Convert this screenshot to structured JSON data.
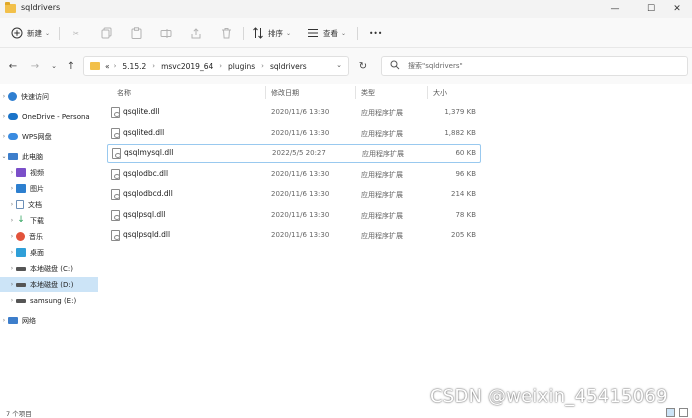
{
  "window": {
    "title": "sqldrivers",
    "minimize": "—",
    "maximize": "☐",
    "close": "✕"
  },
  "toolbar": {
    "new_label": "新建",
    "sort_label": "排序",
    "view_label": "查看",
    "more_label": "•••"
  },
  "nav": {
    "path": [
      "«",
      "5.15.2",
      "msvc2019_64",
      "plugins",
      "sqldrivers"
    ],
    "search_placeholder": "搜索\"sqldrivers\""
  },
  "sidebar": {
    "items": [
      {
        "label": "快速访问",
        "icon": "star-icon",
        "color": "#2f7fd1"
      },
      {
        "label": "OneDrive - Persona",
        "icon": "cloud-icon",
        "color": "#1a73c8"
      },
      {
        "label": "WPS网盘",
        "icon": "cloud-drive-icon",
        "color": "#3a8be0"
      },
      {
        "label": "此电脑",
        "icon": "computer-icon",
        "color": "#3d7ecb"
      },
      {
        "label": "视频",
        "icon": "video-icon",
        "color": "#7b4fc9"
      },
      {
        "label": "图片",
        "icon": "pictures-icon",
        "color": "#2d7fcf"
      },
      {
        "label": "文档",
        "icon": "documents-icon",
        "color": "#6c8fb7"
      },
      {
        "label": "下载",
        "icon": "download-icon",
        "color": "#2aa05a"
      },
      {
        "label": "音乐",
        "icon": "music-icon",
        "color": "#e2533b"
      },
      {
        "label": "桌面",
        "icon": "desktop-icon",
        "color": "#2f9fd8"
      },
      {
        "label": "本地磁盘 (C:)",
        "icon": "drive-icon",
        "color": "#555555"
      },
      {
        "label": "本地磁盘 (D:)",
        "icon": "drive-icon",
        "color": "#555555"
      },
      {
        "label": "samsung (E:)",
        "icon": "drive-icon",
        "color": "#555555"
      },
      {
        "label": "网络",
        "icon": "network-icon",
        "color": "#3d7ecb"
      }
    ]
  },
  "columns": {
    "name": "名称",
    "date": "修改日期",
    "type": "类型",
    "size": "大小"
  },
  "files": [
    {
      "name": "qsqlite.dll",
      "date": "2020/11/6 13:30",
      "type": "应用程序扩展",
      "size": "1,379 KB"
    },
    {
      "name": "qsqlited.dll",
      "date": "2020/11/6 13:30",
      "type": "应用程序扩展",
      "size": "1,882 KB"
    },
    {
      "name": "qsqlmysql.dll",
      "date": "2022/5/5 20:27",
      "type": "应用程序扩展",
      "size": "60 KB"
    },
    {
      "name": "qsqlodbc.dll",
      "date": "2020/11/6 13:30",
      "type": "应用程序扩展",
      "size": "96 KB"
    },
    {
      "name": "qsqlodbcd.dll",
      "date": "2020/11/6 13:30",
      "type": "应用程序扩展",
      "size": "214 KB"
    },
    {
      "name": "qsqlpsql.dll",
      "date": "2020/11/6 13:30",
      "type": "应用程序扩展",
      "size": "78 KB"
    },
    {
      "name": "qsqlpsqld.dll",
      "date": "2020/11/6 13:30",
      "type": "应用程序扩展",
      "size": "205 KB"
    }
  ],
  "status": {
    "count": "7 个项目"
  },
  "watermark": "CSDN @weixin_45415069"
}
